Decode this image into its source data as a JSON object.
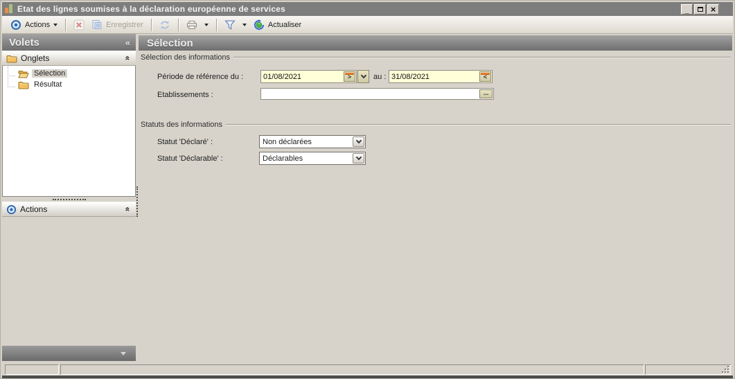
{
  "window": {
    "title": "Etat des lignes soumises à la déclaration européenne de services",
    "controls": {
      "minimize_glyph": "_",
      "maximize_glyph": "",
      "close_glyph": "×"
    }
  },
  "toolbar": {
    "actions_label": "Actions",
    "enregistrer_label": "Enregistrer",
    "actualiser_label": "Actualiser"
  },
  "sidebar": {
    "title": "Volets",
    "collapse_glyph": "«",
    "chevron_glyph": "«",
    "onglets_label": "Onglets",
    "actions_label": "Actions",
    "tree": [
      {
        "label": "Sélection"
      },
      {
        "label": "Résultat"
      }
    ]
  },
  "main": {
    "title": "Sélection",
    "group_selection": "Sélection des informations",
    "group_statuts": "Statuts des informations",
    "periode_label": "Période de référence du :",
    "date_from": "01/08/2021",
    "au_label": "au :",
    "date_to": "31/08/2021",
    "next_glyph": ">",
    "prev_glyph": "<",
    "etablissements_label": "Etablissements :",
    "etablissements_value": "",
    "browse_label": "...",
    "statut_declare_label": "Statut 'Déclaré' :",
    "statut_declare_value": "Non déclarées",
    "statut_declarable_label": "Statut 'Déclarable' :",
    "statut_declarable_value": "Déclarables"
  },
  "colors": {
    "titlebar": "#7d7d7d",
    "accent-blue": "#2c67b0",
    "field-yellow": "#ffffd8",
    "orange": "#ef8a4a",
    "green": "#49b84d"
  }
}
